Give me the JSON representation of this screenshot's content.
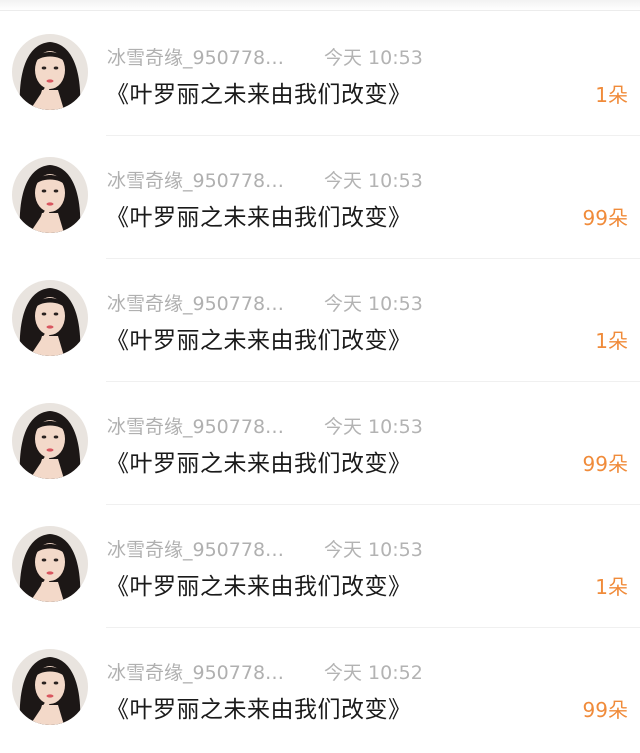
{
  "items": [
    {
      "username": "冰雪奇缘_950778…",
      "time": "今天 10:53",
      "title": "《叶罗丽之未来由我们改变》",
      "count": "1朵"
    },
    {
      "username": "冰雪奇缘_950778…",
      "time": "今天 10:53",
      "title": "《叶罗丽之未来由我们改变》",
      "count": "99朵"
    },
    {
      "username": "冰雪奇缘_950778…",
      "time": "今天 10:53",
      "title": "《叶罗丽之未来由我们改变》",
      "count": "1朵"
    },
    {
      "username": "冰雪奇缘_950778…",
      "time": "今天 10:53",
      "title": "《叶罗丽之未来由我们改变》",
      "count": "99朵"
    },
    {
      "username": "冰雪奇缘_950778…",
      "time": "今天 10:53",
      "title": "《叶罗丽之未来由我们改变》",
      "count": "1朵"
    },
    {
      "username": "冰雪奇缘_950778…",
      "time": "今天 10:52",
      "title": "《叶罗丽之未来由我们改变》",
      "count": "99朵"
    }
  ],
  "colors": {
    "accent": "#f08b3a",
    "meta_text": "#b0b0b0",
    "title_text": "#1a1a1a"
  },
  "icons": {
    "avatar": "user-avatar-photo"
  }
}
